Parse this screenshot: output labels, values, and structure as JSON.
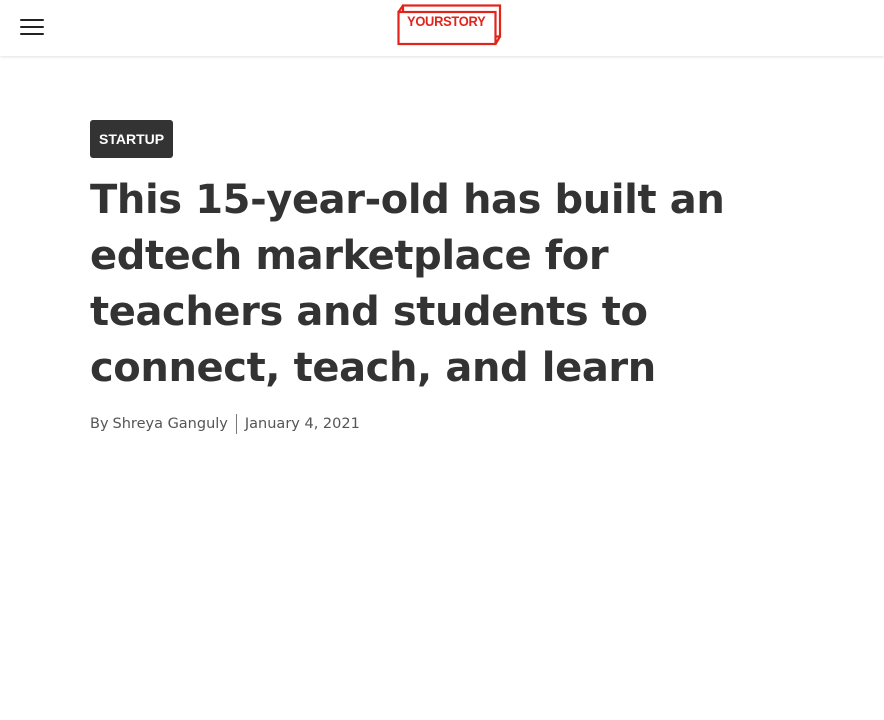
{
  "header": {
    "menu_icon": "hamburger-menu-icon",
    "logo_text": "YOURSTORY",
    "brand_color": "#e2231a"
  },
  "article": {
    "category": "STARTUP",
    "title": "This 15-year-old has built an edtech marketplace for teachers and students to connect, teach, and learn",
    "byline_prefix": "By",
    "author": "Shreya Ganguly",
    "date": "January 4, 2021"
  }
}
